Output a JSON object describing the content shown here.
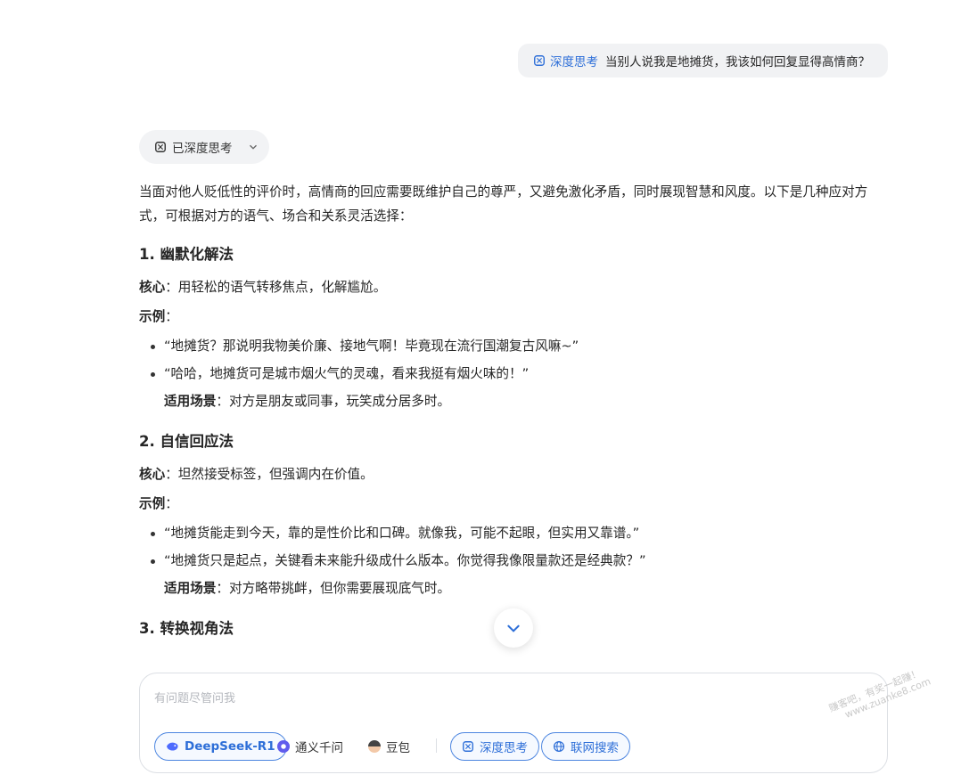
{
  "user_message": {
    "tag": "深度思考",
    "text": "当别人说我是地摊货，我该如何回复显得高情商？"
  },
  "think_toggle": {
    "label": "已深度思考"
  },
  "answer": {
    "intro": "当面对他人贬低性的评价时，高情商的回应需要既维护自己的尊严，又避免激化矛盾，同时展现智慧和风度。以下是几种应对方式，可根据对方的语气、场合和关系灵活选择：",
    "sections": [
      {
        "heading": "1. 幽默化解法",
        "core_label": "核心",
        "core_text": "：用轻松的语气转移焦点，化解尴尬。",
        "example_label": "示例",
        "example_colon": "：",
        "bullets": [
          "“地摊货？那说明我物美价廉、接地气啊！毕竟现在流行国潮复古风嘛~”",
          "“哈哈，地摊货可是城市烟火气的灵魂，看来我挺有烟火味的！”"
        ],
        "scene_label": "适用场景",
        "scene_text": "：对方是朋友或同事，玩笑成分居多时。"
      },
      {
        "heading": "2. 自信回应法",
        "core_label": "核心",
        "core_text": "：坦然接受标签，但强调内在价值。",
        "example_label": "示例",
        "example_colon": "：",
        "bullets": [
          "“地摊货能走到今天，靠的是性价比和口碑。就像我，可能不起眼，但实用又靠谱。”",
          "“地摊货只是起点，关键看未来能升级成什么版本。你觉得我像限量款还是经典款？”"
        ],
        "scene_label": "适用场景",
        "scene_text": "：对方略带挑衅，但你需要展现底气时。"
      },
      {
        "heading": "3. 转换视角法"
      }
    ]
  },
  "input": {
    "placeholder": "有问题尽管问我",
    "models": [
      "DeepSeek-R1",
      "通义千问",
      "豆包"
    ],
    "toggles": [
      "深度思考",
      "联网搜索"
    ]
  },
  "watermark": {
    "line1": "赚客吧，有奖一起赚！",
    "line2": "www.zuanke8.com"
  },
  "colors": {
    "accent": "#2e6fd8",
    "bubble_bg": "#f1f2f4",
    "text": "#262626"
  }
}
